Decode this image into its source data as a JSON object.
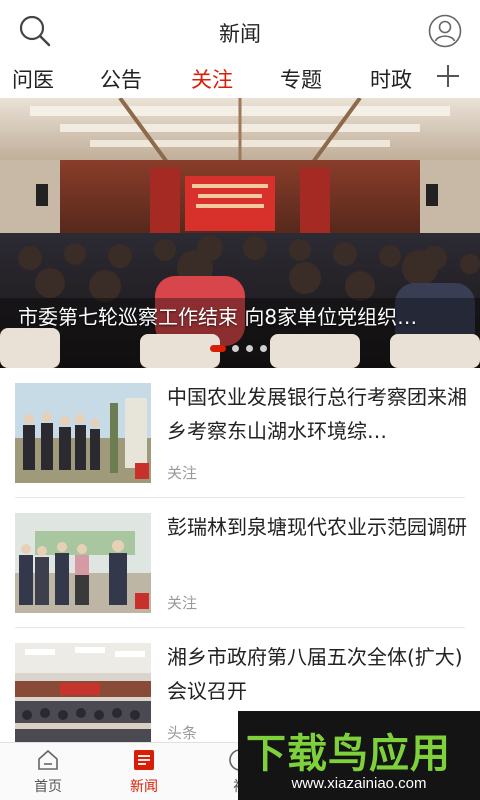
{
  "header": {
    "title": "新闻"
  },
  "tabs": [
    {
      "label": "问医",
      "active": false
    },
    {
      "label": "公告",
      "active": false
    },
    {
      "label": "关注",
      "active": true
    },
    {
      "label": "专题",
      "active": false
    },
    {
      "label": "时政",
      "active": false
    }
  ],
  "banner": {
    "caption": "市委第七轮巡察工作结束 向8家单位党组织…",
    "slide_count": 4,
    "active_slide": 1
  },
  "news": [
    {
      "headline": "中国农业发展银行总行考察团来湘乡考察东山湖水环境综…",
      "tag": "关注"
    },
    {
      "headline": "彭瑞林到泉塘现代农业示范园调研",
      "tag": "关注"
    },
    {
      "headline": "湘乡市政府第八届五次全体(扩大)会议召开",
      "tag": "头条"
    }
  ],
  "bottom_nav": [
    {
      "label": "首页",
      "icon": "home-icon",
      "active": false
    },
    {
      "label": "新闻",
      "icon": "news-icon",
      "active": true
    },
    {
      "label": "视",
      "icon": "video-icon",
      "active": false
    }
  ],
  "watermark": {
    "main": "下载鸟应用",
    "url": "www.xiazainiao.com"
  },
  "colors": {
    "accent": "#d81e06",
    "watermark_green": "#7fd13c"
  }
}
